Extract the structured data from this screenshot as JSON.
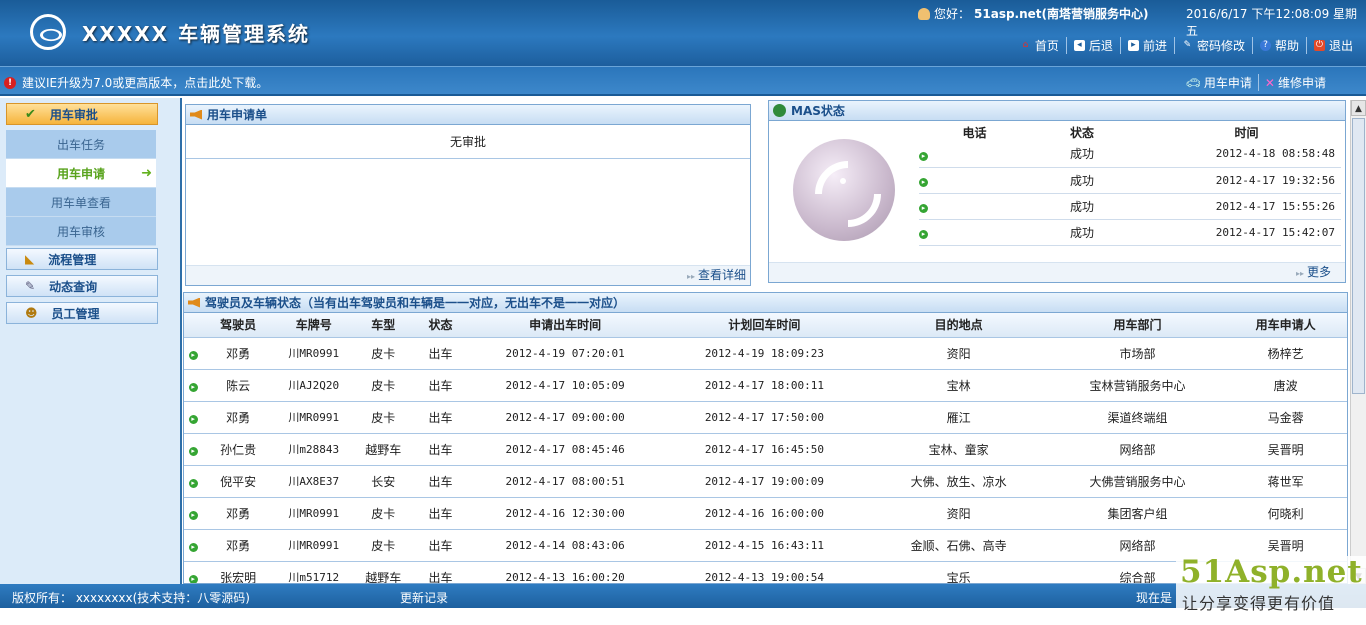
{
  "header": {
    "title": "XXXXX  车辆管理系统",
    "greeting_prefix": "您好：",
    "user": "51asp.net(南塔营销服务中心)",
    "datetime": "2016/6/17 下午12:08:09 星期五",
    "nav": [
      {
        "label": "首页",
        "icon": "home-icon"
      },
      {
        "label": "后退",
        "icon": "back-icon"
      },
      {
        "label": "前进",
        "icon": "forward-icon"
      },
      {
        "label": "密码修改",
        "icon": "password-icon"
      },
      {
        "label": "帮助",
        "icon": "help-icon"
      },
      {
        "label": "退出",
        "icon": "exit-icon"
      }
    ]
  },
  "notice": {
    "text": "建议IE升级为7.0或更高版本，点击此处下载。",
    "quick_links": [
      {
        "label": "用车申请",
        "icon": "car-icon"
      },
      {
        "label": "维修申请",
        "icon": "wrench-icon"
      }
    ]
  },
  "sidebar": {
    "groups": [
      {
        "label": "用车审批",
        "icon": "check-icon",
        "active": true,
        "items": [
          {
            "label": "出车任务"
          },
          {
            "label": "用车申请",
            "active": true
          },
          {
            "label": "用车单查看"
          },
          {
            "label": "用车审核"
          }
        ]
      },
      {
        "label": "流程管理",
        "icon": "ruler-icon"
      },
      {
        "label": "动态查询",
        "icon": "edit-icon"
      },
      {
        "label": "员工管理",
        "icon": "person-icon"
      }
    ]
  },
  "application_panel": {
    "title": "用车申请单",
    "empty_text": "无审批",
    "more_label": "查看详细"
  },
  "mas_panel": {
    "title": "MAS状态",
    "columns": [
      "电话",
      "状态",
      "时间"
    ],
    "rows": [
      {
        "phone": "",
        "status": "成功",
        "time": "2012-4-18 08:58:48"
      },
      {
        "phone": "",
        "status": "成功",
        "time": "2012-4-17 19:32:56"
      },
      {
        "phone": "",
        "status": "成功",
        "time": "2012-4-17 15:55:26"
      },
      {
        "phone": "",
        "status": "成功",
        "time": "2012-4-17 15:42:07"
      }
    ],
    "more_label": "更多"
  },
  "driver_panel": {
    "title": "驾驶员及车辆状态（当有出车驾驶员和车辆是一一对应，无出车不是一一对应）",
    "columns": [
      "驾驶员",
      "车牌号",
      "车型",
      "状态",
      "申请出车时间",
      "计划回车时间",
      "目的地点",
      "用车部门",
      "用车申请人"
    ],
    "rows": [
      [
        "邓勇",
        "川MR0991",
        "皮卡",
        "出车",
        "2012-4-19 07:20:01",
        "2012-4-19 18:09:23",
        "资阳",
        "市场部",
        "杨梓艺"
      ],
      [
        "陈云",
        "川AJ2Q20",
        "皮卡",
        "出车",
        "2012-4-17 10:05:09",
        "2012-4-17 18:00:11",
        "宝林",
        "宝林营销服务中心",
        "唐波"
      ],
      [
        "邓勇",
        "川MR0991",
        "皮卡",
        "出车",
        "2012-4-17 09:00:00",
        "2012-4-17 17:50:00",
        "雁江",
        "渠道终端组",
        "马金蓉"
      ],
      [
        "孙仁贵",
        "川m28843",
        "越野车",
        "出车",
        "2012-4-17 08:45:46",
        "2012-4-17 16:45:50",
        "宝林、童家",
        "网络部",
        "吴晋明"
      ],
      [
        "倪平安",
        "川AX8E37",
        "长安",
        "出车",
        "2012-4-17 08:00:51",
        "2012-4-17 19:00:09",
        "大佛、放生、凉水",
        "大佛营销服务中心",
        "蒋世军"
      ],
      [
        "邓勇",
        "川MR0991",
        "皮卡",
        "出车",
        "2012-4-16 12:30:00",
        "2012-4-16 16:00:00",
        "资阳",
        "集团客户组",
        "何晓利"
      ],
      [
        "邓勇",
        "川MR0991",
        "皮卡",
        "出车",
        "2012-4-14 08:43:06",
        "2012-4-15 16:43:11",
        "金顺、石佛、高寺",
        "网络部",
        "吴晋明"
      ],
      [
        "张宏明",
        "川m51712",
        "越野车",
        "出车",
        "2012-4-13 16:00:20",
        "2012-4-13 19:00:54",
        "宝乐",
        "综合部",
        ""
      ]
    ]
  },
  "footer": {
    "copyright": "版权所有： xxxxxxxx(技术支持：八零源码)",
    "changelog": "更新记录",
    "now_label": "现在是"
  },
  "watermark": {
    "logo": "51Asp.net",
    "slogan": "让分享变得更有价值"
  },
  "colors": {
    "header_blue": "#2c79bf",
    "active_orange": "#f6b43c",
    "sub_active_green": "#58a31c"
  }
}
